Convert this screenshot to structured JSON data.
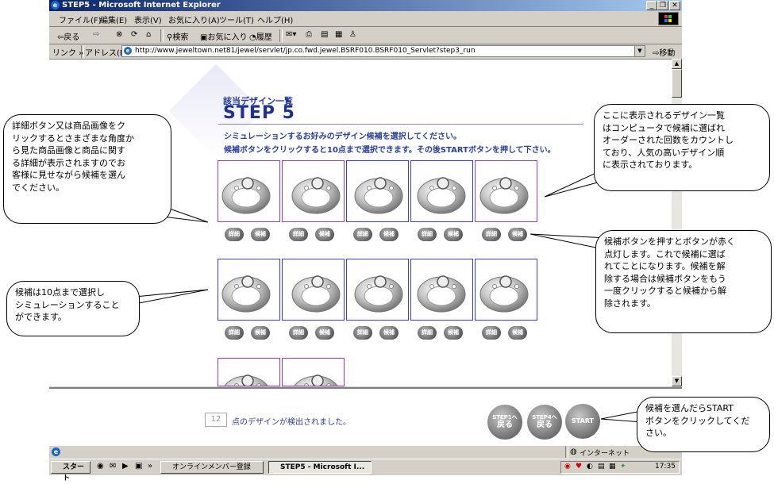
{
  "window": {
    "title": "STEP5 - Microsoft Internet Explorer",
    "controls": [
      "_",
      "❐",
      "✕"
    ]
  },
  "menu": [
    "ファイル(F)",
    "編集(E)",
    "表示(V)",
    "お気に入り(A)",
    "ツール(T)",
    "ヘルプ(H)"
  ],
  "toolbar": {
    "back": "⇦戻る",
    "forward": "⇨",
    "search": "検索",
    "favorites": "お気に入り",
    "history": "履歴"
  },
  "address": {
    "links_label": "リンク »",
    "label": "アドレス(D)",
    "url": "http://www.jeweltown.net81/jewel/servlet/jp.co.fwd.jewel.BSRF010.BSRF010_Servlet?step3_run",
    "go_label": "移動"
  },
  "page": {
    "subtitle": "該当デザイン一覧",
    "title": "STEP 5",
    "instruction1": "シミュレーションするお好みのデザイン候補を選択してください。",
    "instruction2": "候補ボタンをクリックすると10点まで選択できます。その後STARTボタンを押して下さい。",
    "detail_label": "詳細",
    "candidate_label": "候補",
    "rings_row1": 5,
    "rings_row2": 5,
    "rings_row3_visible": 2
  },
  "bottom": {
    "count_value": "12",
    "count_text": "点のデザインが検出されました。",
    "step1_back": [
      "STEP1へ",
      "戻る"
    ],
    "step4_back": [
      "STEP4へ",
      "戻る"
    ],
    "start": "START"
  },
  "status": {
    "zone": "インターネット"
  },
  "taskbar": {
    "start": "スタート",
    "task1": "オンラインメンバー登録",
    "task2": "STEP5 - Microsoft I...",
    "clock": "17:35"
  },
  "callouts": {
    "detail_help": [
      "詳細ボタン又は商品画像をク",
      "リックするとさまざまな角度か",
      "ら見た商品画像と商品に関す",
      "る詳細が表示されますのでお",
      "客様に見せながら候補を選ん",
      "でください。"
    ],
    "ranking_help": [
      "ここに表示されるデザイン一覧",
      "はコンピュータで候補に選ばれ",
      "オーダーされた回数をカウントし",
      "ており、人気の高いデザイン順",
      "に表示されております。"
    ],
    "candidate_help": [
      "候補ボタンを押すとボタンが赤く",
      "点灯します。これで候補に選ば",
      "れてことになります。候補を解",
      "除する場合は候補ボタンをもう",
      "一度クリックすると候補から解",
      "除されます。"
    ],
    "limit_help": [
      "候補は10点まで選択し",
      "シミュレーションすること",
      "ができます。"
    ],
    "start_help": [
      "候補を選んだらSTART",
      "ボタンをクリックしてくだ",
      "さい。"
    ]
  },
  "colors": {
    "accent_blue": "#2a3e9e",
    "ring_border_blue": "#3a3aee",
    "ring_border_purple": "#a040b0"
  }
}
